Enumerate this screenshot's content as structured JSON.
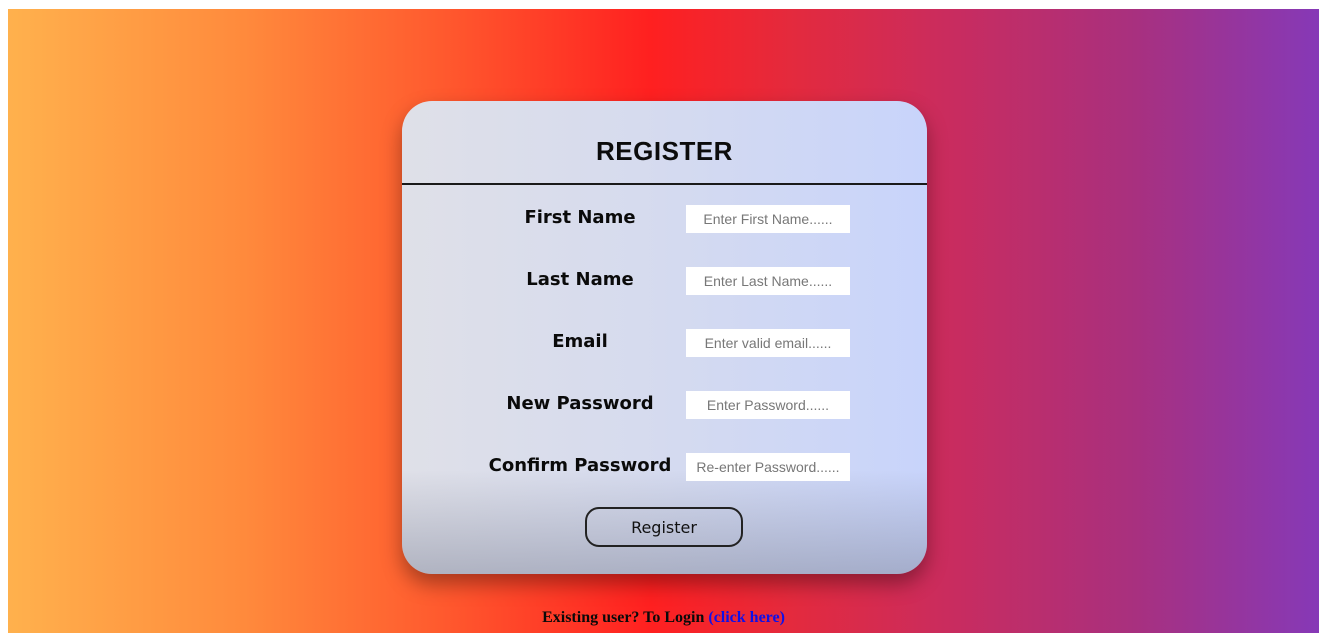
{
  "form": {
    "title": "REGISTER",
    "fields": [
      {
        "label": "First Name",
        "placeholder": "Enter First Name......"
      },
      {
        "label": "Last Name",
        "placeholder": "Enter Last Name......"
      },
      {
        "label": "Email",
        "placeholder": "Enter valid email......"
      },
      {
        "label": "New Password",
        "placeholder": "Enter Password......"
      },
      {
        "label": "Confirm Password",
        "placeholder": "Re-enter Password......"
      }
    ],
    "submit_label": "Register"
  },
  "footer": {
    "prompt": "Existing user? To Login",
    "link_text": "(click here)"
  },
  "colors": {
    "gradient_start": "#ffb14d",
    "gradient_mid": "#ff2020",
    "gradient_end": "#8639b7",
    "link": "#1010e8"
  }
}
